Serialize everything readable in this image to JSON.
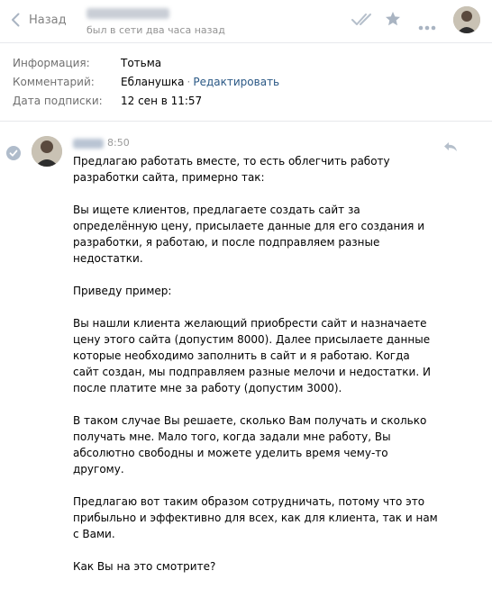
{
  "header": {
    "back_label": "Назад",
    "contact_status": "был в сети два часа назад",
    "icons": [
      "back-chevron-icon",
      "double-check-icon",
      "star-icon",
      "more-icon"
    ]
  },
  "info": {
    "rows": [
      {
        "label": "Информация:",
        "value": "Тотьма"
      },
      {
        "label": "Комментарий:",
        "value": "Ебланушка",
        "link": "Редактировать"
      },
      {
        "label": "Дата подписки:",
        "value": "12 сен в 11:57"
      }
    ],
    "separator": "·"
  },
  "message": {
    "time": "8:50",
    "paragraphs": [
      "Предлагаю работать вместе, то есть облегчить работу разработки сайта, примерно так:",
      "Вы ищете клиентов, предлагаете создать сайт за определённую цену, присылаете данные для его создания и разработки, я работаю, и после подправляем разные недостатки.",
      "Приведу пример:",
      "Вы нашли клиента желающий приобрести сайт и назначаете цену этого сайта (допустим 8000). Далее присылаете данные которые необходимо заполнить в сайт и я работаю. Когда сайт создан, мы подправляем разные мелочи и недостатки. И после платите мне за работу (допустим 3000).",
      "В таком случае Вы решаете, сколько Вам получать и сколько получать мне. Мало того, когда задали мне работу, Вы абсолютно свободны и можете уделить время чему-то другому.",
      "Предлагаю вот таким образом сотрудничать, потому что это прибыльно и эффективно для всех, как для клиента, так и нам с Вами.",
      "Как Вы на это смотрите?"
    ]
  },
  "colors": {
    "link": "#2a5885",
    "muted": "#939393",
    "icon": "#a9b4c2",
    "divider": "#e7e8ec"
  }
}
